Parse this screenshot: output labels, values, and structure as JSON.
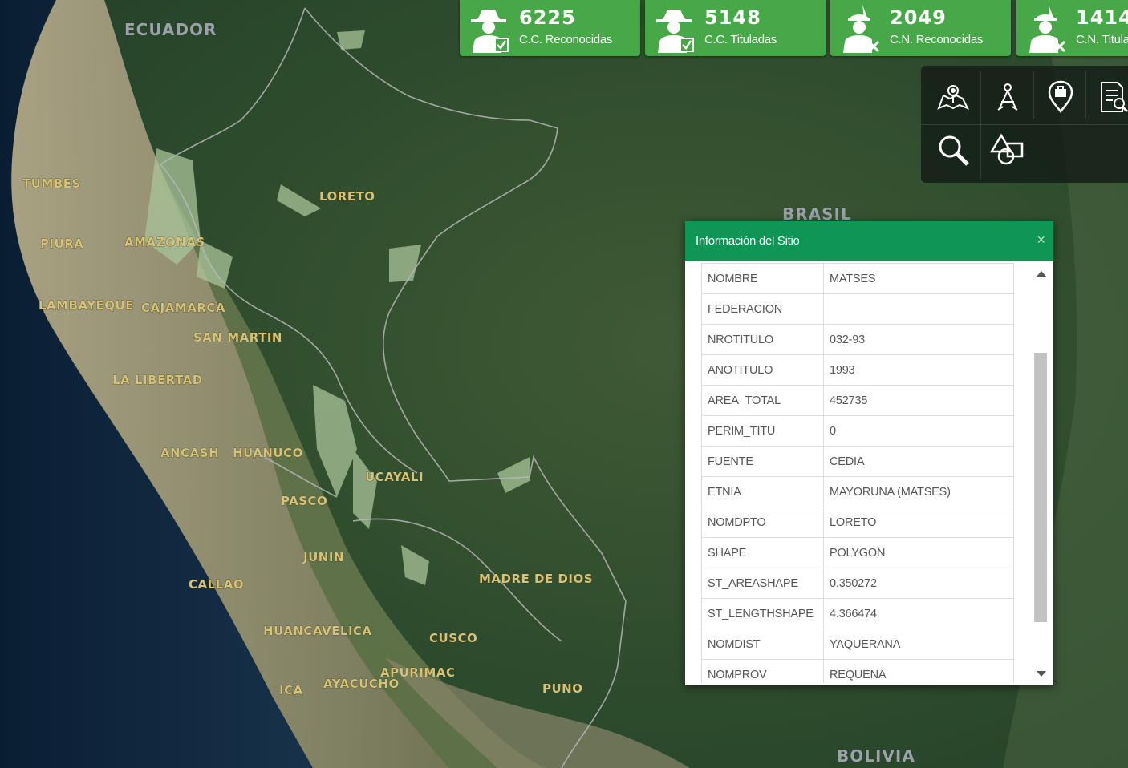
{
  "stats": [
    {
      "count": "6225",
      "label": "C.C. Reconocidas",
      "icon": "comunero-hat-check-icon"
    },
    {
      "count": "5148",
      "label": "C.C. Tituladas",
      "icon": "comunero-hat-check-icon"
    },
    {
      "count": "2049",
      "label": "C.N. Reconocidas",
      "icon": "native-feather-check-icon"
    },
    {
      "count": "1414",
      "label": "C.N. Tituladas",
      "icon": "native-feather-check-icon"
    }
  ],
  "toolbar": {
    "icons": [
      "map-layers-icon",
      "measure-compass-icon",
      "location-pin-icon",
      "report-document-icon",
      "search-icon",
      "draw-shapes-icon"
    ]
  },
  "map": {
    "country_labels": {
      "ecuador": "ECUADOR",
      "brasil": "BRASIL",
      "bolivia": "BOLIVIA"
    },
    "region_labels": {
      "tumbes": "TUMBES",
      "loreto": "LORETO",
      "piura": "PIURA",
      "amazonas": "AMAZONAS",
      "lambayeque": "LAMBAYEQUE",
      "cajamarca": "CAJAMARCA",
      "san_martin": "SAN MARTIN",
      "la_libertad": "LA LIBERTAD",
      "ancash": "ANCASH",
      "huanuco": "HUANUCO",
      "ucayali": "UCAYALI",
      "pasco": "PASCO",
      "junin": "JUNIN",
      "callao": "CALLAO",
      "madre_de_dios": "MADRE DE DIOS",
      "huancavelica": "HUANCAVELICA",
      "cusco": "CUSCO",
      "apurimac": "APURIMAC",
      "ica": "ICA",
      "ayacucho": "AYACUCHO",
      "puno": "PUNO"
    }
  },
  "popup": {
    "title": "Información del Sitio",
    "close": "×",
    "rows": [
      {
        "key": "NOMBRE",
        "value": "MATSES"
      },
      {
        "key": "FEDERACION",
        "value": ""
      },
      {
        "key": "NROTITULO",
        "value": "032-93"
      },
      {
        "key": "ANOTITULO",
        "value": "1993"
      },
      {
        "key": "AREA_TOTAL",
        "value": "452735"
      },
      {
        "key": "PERIM_TITU",
        "value": "0"
      },
      {
        "key": "FUENTE",
        "value": "CEDIA"
      },
      {
        "key": "ETNIA",
        "value": "MAYORUNA (MATSES)"
      },
      {
        "key": "NOMDPTO",
        "value": "LORETO"
      },
      {
        "key": "SHAPE",
        "value": "POLYGON"
      },
      {
        "key": "ST_AREASHAPE",
        "value": "0.350272"
      },
      {
        "key": "ST_LENGTHSHAPE",
        "value": "4.366474"
      },
      {
        "key": "NOMDIST",
        "value": "YAQUERANA"
      },
      {
        "key": "NOMPROV",
        "value": "REQUENA"
      }
    ]
  }
}
